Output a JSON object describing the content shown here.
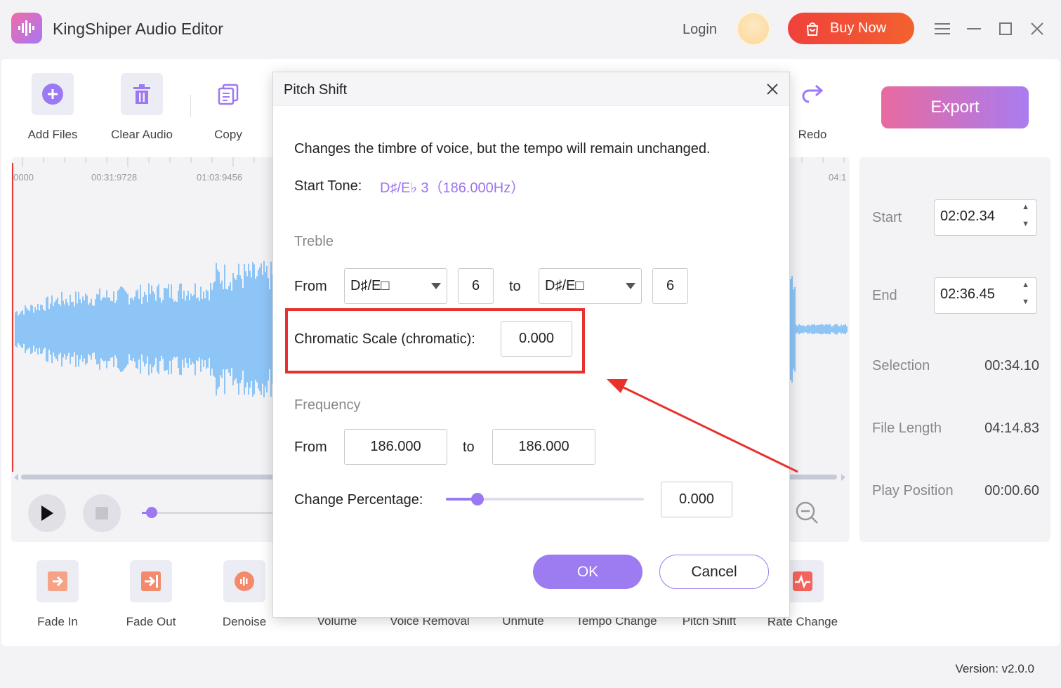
{
  "app": {
    "title": "KingShiper Audio Editor",
    "login_label": "Login",
    "buy_label": "Buy Now",
    "version": "Version: v2.0.0"
  },
  "toolbar": {
    "add_files": "Add Files",
    "clear_audio": "Clear Audio",
    "copy": "Copy",
    "redo": "Redo",
    "export": "Export"
  },
  "timeline": {
    "ticks": [
      "0000",
      "00:31:9728",
      "01:03:9456",
      "04:1"
    ]
  },
  "side": {
    "start_label": "Start",
    "start_value": "02:02.34",
    "end_label": "End",
    "end_value": "02:36.45",
    "selection_label": "Selection",
    "selection_value": "00:34.10",
    "file_length_label": "File Length",
    "file_length_value": "04:14.83",
    "play_position_label": "Play Position",
    "play_position_value": "00:00.60"
  },
  "effects": {
    "fade_in": "Fade In",
    "fade_out": "Fade Out",
    "denoise": "Denoise",
    "volume": "Volume",
    "voice_removal": "Voice Removal",
    "unmute": "Unmute",
    "tempo_change": "Tempo Change",
    "pitch_shift": "Pitch Shift",
    "rate_change": "Rate Change"
  },
  "dialog": {
    "title": "Pitch Shift",
    "description": "Changes the timbre of voice, but the tempo will remain unchanged.",
    "start_tone_label": "Start Tone:",
    "start_tone_value": "D♯/E♭ 3（186.000Hz）",
    "treble_section": "Treble",
    "from_label": "From",
    "to_label": "to",
    "treble_from_note": "D♯/E□",
    "treble_from_octave": "6",
    "treble_to_note": "D♯/E□",
    "treble_to_octave": "6",
    "chromatic_label": "Chromatic Scale (chromatic):",
    "chromatic_value": "0.000",
    "frequency_section": "Frequency",
    "freq_from_label": "From",
    "freq_from_value": "186.000",
    "freq_to_label": "to",
    "freq_to_value": "186.000",
    "change_pct_label": "Change Percentage:",
    "change_pct_value": "0.000",
    "change_pct_slider_fraction": 0.16,
    "ok_label": "OK",
    "cancel_label": "Cancel"
  },
  "colors": {
    "accent": "#9b79f2",
    "buy": "#f0413c",
    "waveform": "#8ec5f7",
    "highlight": "#e8312c"
  }
}
